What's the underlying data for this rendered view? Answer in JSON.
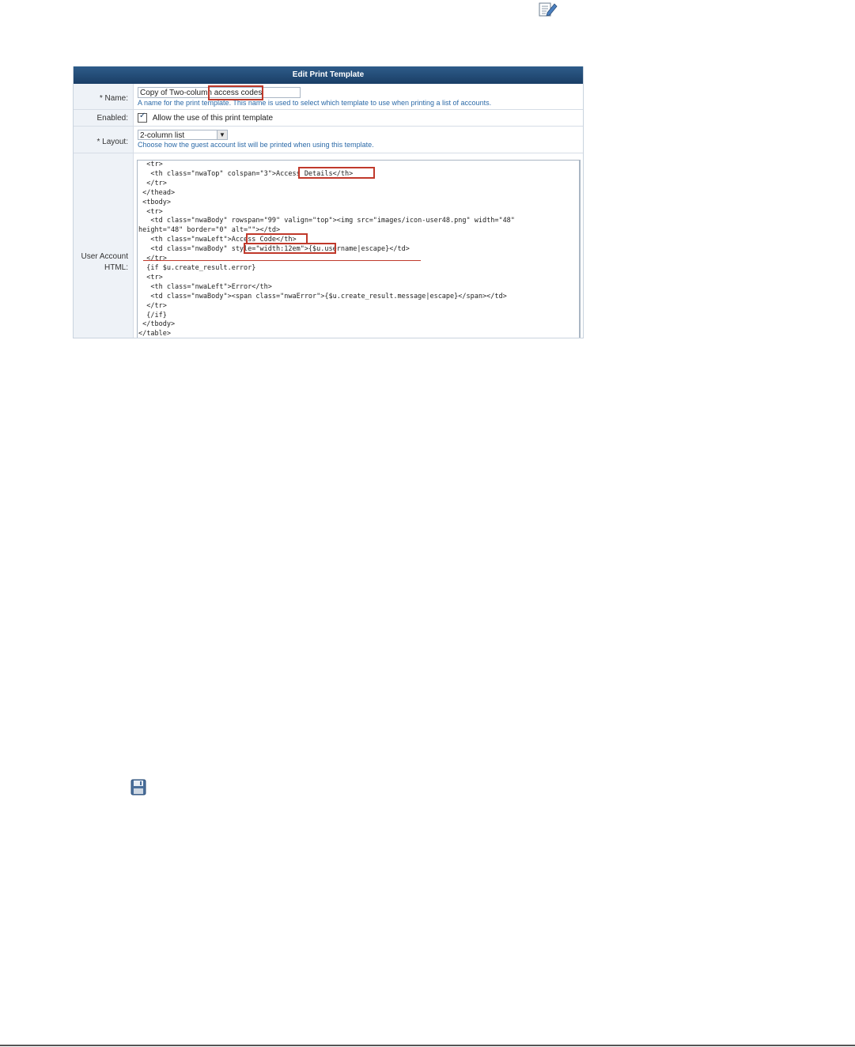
{
  "panel": {
    "title": "Edit Print Template",
    "name": {
      "label": "* Name:",
      "value_prefix": "Copy of Two-column",
      "value_highlight": "access codes",
      "hint": "A name for the print template. This name is used to select which template to use when printing a list of accounts."
    },
    "enabled": {
      "label": "Enabled:",
      "checkbox_label": "Allow the use of this print template",
      "checked": true
    },
    "layout": {
      "label": "* Layout:",
      "selected": "2-column list",
      "hint": "Choose how the guest account list will be printed when using this template."
    },
    "html": {
      "label_line1": "User Account",
      "label_line2": "HTML:",
      "code_lines": [
        "  <tr>",
        "   <th class=\"nwaTop\" colspan=\"3\">Access Details</th>",
        "  </tr>",
        " </thead>",
        " <tbody>",
        "  <tr>",
        "   <td class=\"nwaBody\" rowspan=\"99\" valign=\"top\"><img src=\"images/icon-user48.png\" width=\"48\"",
        "height=\"48\" border=\"0\" alt=\"\"></td>",
        "   <th class=\"nwaLeft\">Access Code</th>",
        "   <td class=\"nwaBody\" style=\"width:12em\">{$u.username|escape}</td>",
        "  </tr>",
        "  {if $u.create_result.error}",
        "  <tr>",
        "   <th class=\"nwaLeft\">Error</th>",
        "   <td class=\"nwaBody\"><span class=\"nwaError\">{$u.create_result.message|escape}</span></td>",
        "  </tr>",
        "  {/if}",
        " </tbody>",
        "</table>"
      ]
    }
  },
  "icons": {
    "edit": "edit-document-icon",
    "save": "save-disk-icon"
  },
  "colors": {
    "header": "#1a3e66",
    "highlight": "#c0392b",
    "hint": "#2c6aa8"
  }
}
